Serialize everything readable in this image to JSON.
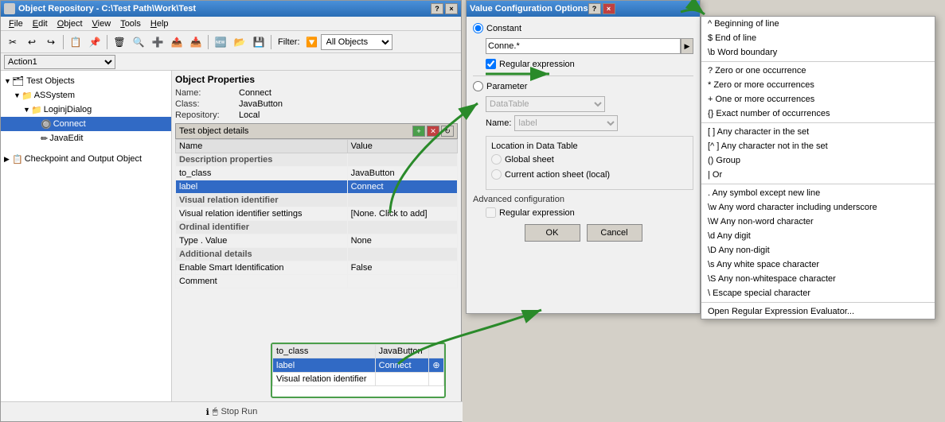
{
  "mainWindow": {
    "title": "Object Repository - C:\\Test Path\\Work\\Test",
    "titleBtns": [
      "?",
      "×"
    ]
  },
  "menuBar": {
    "items": [
      "File",
      "Edit",
      "Object",
      "View",
      "Tools",
      "Help"
    ]
  },
  "toolbar": {
    "filterLabel": "Filter:",
    "filterValue": "All Objects"
  },
  "actionBar": {
    "action": "Action1"
  },
  "treePanel": {
    "rootLabel": "Test Objects",
    "items": [
      {
        "label": "ASSystem",
        "indent": 1,
        "icon": "📁",
        "expanded": true
      },
      {
        "label": "LoginjDialog",
        "indent": 2,
        "icon": "📁",
        "expanded": true
      },
      {
        "label": "Connect",
        "indent": 3,
        "icon": "🔘",
        "selected": true
      },
      {
        "label": "JavaEdit",
        "indent": 3,
        "icon": "✏"
      }
    ],
    "checkpointLabel": "Checkpoint and Output Object"
  },
  "objectProperties": {
    "title": "Object Properties",
    "name": {
      "label": "Name:",
      "value": "Connect"
    },
    "class": {
      "label": "Class:",
      "value": "JavaButton"
    },
    "repository": {
      "label": "Repository:",
      "value": "Local"
    }
  },
  "testObjectDetails": {
    "title": "Test object details",
    "columns": [
      "Name",
      "Value"
    ],
    "rows": [
      {
        "type": "group",
        "name": "Description properties",
        "value": ""
      },
      {
        "type": "data",
        "name": "to_class",
        "value": "JavaButton"
      },
      {
        "type": "selected",
        "name": "label",
        "value": "Connect"
      },
      {
        "type": "group",
        "name": "Visual relation identifier",
        "value": ""
      },
      {
        "type": "data",
        "name": "Visual relation identifier settings",
        "value": "[None. Click to add]"
      },
      {
        "type": "group",
        "name": "Ordinal identifier",
        "value": ""
      },
      {
        "type": "data",
        "name": "Type . Value",
        "value": "None"
      },
      {
        "type": "group",
        "name": "Additional details",
        "value": ""
      },
      {
        "type": "data",
        "name": "Enable Smart Identification",
        "value": "False"
      },
      {
        "type": "data",
        "name": "Comment",
        "value": ""
      }
    ]
  },
  "vcoDialog": {
    "title": "Value Configuration Options",
    "titleBtns": [
      "?",
      "×"
    ],
    "constantLabel": "Constant",
    "constantValue": "Conne.*",
    "regexChecked": true,
    "regexLabel": "Regular expression",
    "parameterLabel": "Parameter",
    "parameterValue": "DataTable",
    "nameLabel": "Name:",
    "nameValue": "label",
    "locationTitle": "Location in Data Table",
    "globalSheet": "Global sheet",
    "currentSheet": "Current action sheet (local)",
    "advancedTitle": "Advanced configuration",
    "advancedRegex": "Regular expression",
    "okLabel": "OK",
    "cancelLabel": "Cancel"
  },
  "contextMenu": {
    "items": [
      {
        "text": "^ Beginning of line"
      },
      {
        "text": "$ End of line"
      },
      {
        "text": "\\b Word boundary"
      },
      {
        "sep": true
      },
      {
        "text": "? Zero or one occurrence"
      },
      {
        "text": "* Zero or more occurrences"
      },
      {
        "text": "+ One or more occurrences"
      },
      {
        "text": "{} Exact number of occurrences"
      },
      {
        "sep": true
      },
      {
        "text": "[ ] Any character in the set"
      },
      {
        "text": "[^ ] Any character not in the set"
      },
      {
        "text": "() Group"
      },
      {
        "text": "| Or"
      },
      {
        "sep": true
      },
      {
        "text": ". Any symbol except new line"
      },
      {
        "text": "\\w Any word character including underscore"
      },
      {
        "text": "\\W Any non-word character"
      },
      {
        "text": "\\d Any digit"
      },
      {
        "text": "\\D Any non-digit"
      },
      {
        "text": "\\s Any white space character"
      },
      {
        "text": "\\S Any non-whitespace character"
      },
      {
        "text": "\\ Escape special character"
      },
      {
        "sep": true
      },
      {
        "text": "Open Regular Expression Evaluator..."
      }
    ]
  },
  "statusBar": {
    "stopLabel": "Stop Run",
    "infoIcon": "ℹ",
    "cursorIcon": "🖱"
  },
  "zoomArea": {
    "rows": [
      {
        "type": "group",
        "name": "to_class",
        "value": "JavaButton"
      },
      {
        "type": "selected",
        "name": "label",
        "value": "Connect"
      },
      {
        "type": "data",
        "name": "Visual relation identifier",
        "value": ""
      }
    ]
  }
}
